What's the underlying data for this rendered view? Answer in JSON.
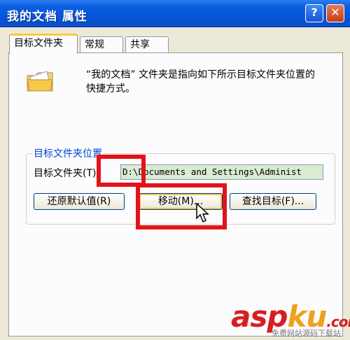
{
  "window": {
    "title": "我的文档 属性",
    "help_label": "?",
    "close_label": "✕"
  },
  "tabs": [
    {
      "label": "目标文件夹"
    },
    {
      "label": "常规"
    },
    {
      "label": "共享"
    }
  ],
  "description": "“我的文档” 文件夹是指向如下所示目标文件夹位置的快捷方式。",
  "group": {
    "legend": "目标文件夹位置",
    "field_label": "目标文件夹(T):",
    "field_value": "D:\\Documents and Settings\\Administ"
  },
  "buttons": {
    "restore_default": "还原默认值(R)",
    "move": "移动(M)...",
    "find_target": "查找目标(F)..."
  },
  "watermark": {
    "part1": "asp",
    "part2": "ku",
    "part3": ".com",
    "subtitle": "免费网站源码下载站"
  },
  "colors": {
    "titlebar": "#0a5fe0",
    "highlight_box": "#e2131a",
    "field_background": "#d9ebd0"
  }
}
